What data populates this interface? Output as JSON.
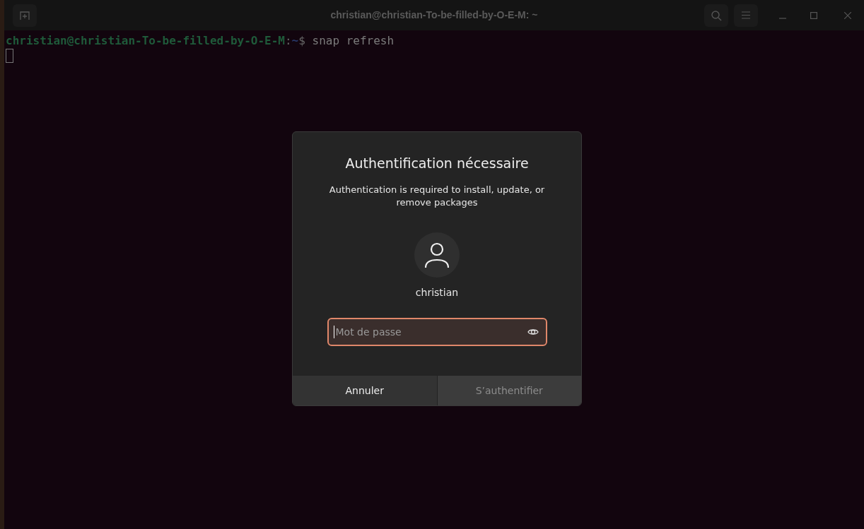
{
  "window": {
    "title": "christian@christian-To-be-filled-by-O-E-M: ~"
  },
  "terminal": {
    "prompt_user": "christian@christian-To-be-filled-by-O-E-M",
    "prompt_separator": ":",
    "prompt_path": "~",
    "prompt_symbol": "$",
    "command": "snap refresh"
  },
  "dialog": {
    "title": "Authentification nécessaire",
    "message": "Authentication is required to install, update, or remove packages",
    "user": "christian",
    "password_field": {
      "placeholder": "Mot de passe",
      "focused": true
    },
    "buttons": [
      {
        "label": "Annuler",
        "disabled": false
      },
      {
        "label": "S’authentifier",
        "disabled": true
      }
    ]
  }
}
